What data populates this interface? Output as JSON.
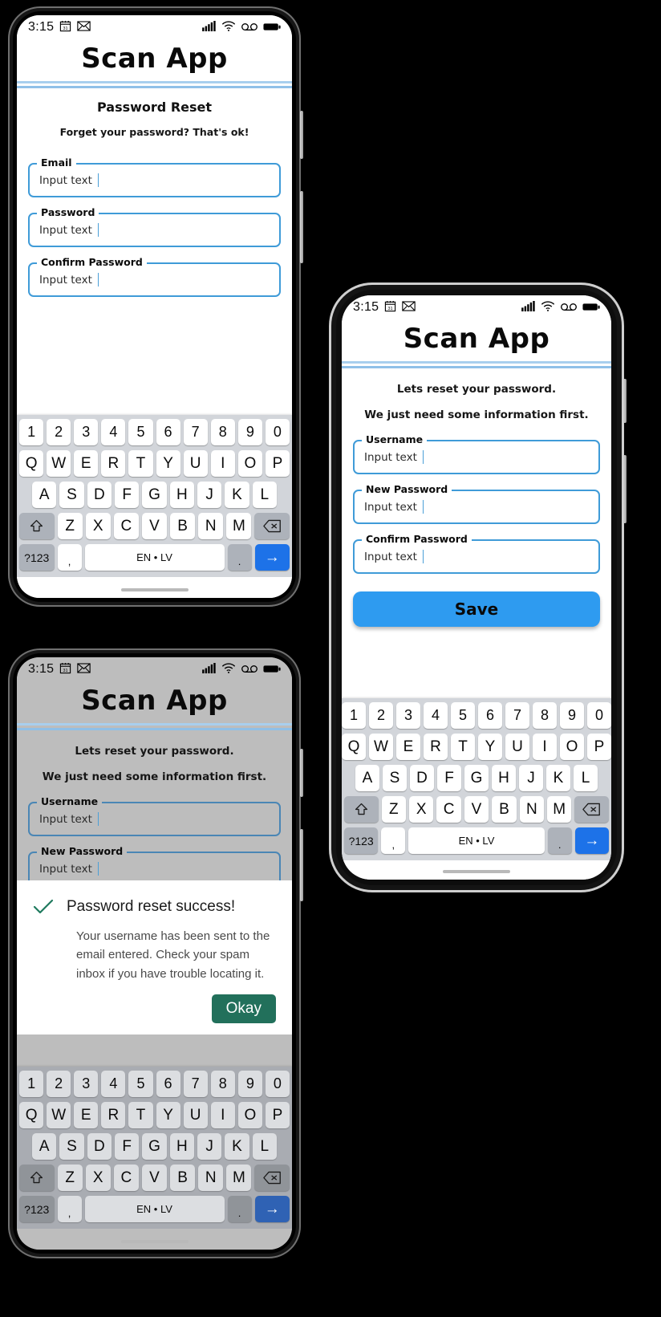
{
  "status_bar": {
    "time": "3:15",
    "left_icons": [
      "calendar-icon",
      "mail-icon"
    ],
    "calendar_day": "31",
    "right_icons": [
      "signal-icon",
      "wifi-icon",
      "voicemail-icon",
      "battery-icon"
    ]
  },
  "app": {
    "title": "Scan App",
    "stripe_color_top": "#a8cfee",
    "stripe_color_bottom": "#8fc0e8"
  },
  "screen1": {
    "heading": "Password Reset",
    "helper": "Forget your password? That's ok!",
    "fields": [
      {
        "label": "Email",
        "value": "Input text"
      },
      {
        "label": "Password",
        "value": "Input text"
      },
      {
        "label": "Confirm Password",
        "value": "Input text"
      }
    ]
  },
  "screen2": {
    "line1": "Lets reset your password.",
    "line2": "We just need some information first.",
    "fields": [
      {
        "label": "Username",
        "value": "Input text"
      },
      {
        "label": "New Password",
        "value": "Input text"
      },
      {
        "label": "Confirm Password",
        "value": "Input text"
      }
    ],
    "save_label": "Save",
    "save_color": "#2e9bf0"
  },
  "screen3": {
    "line1": "Lets reset your password.",
    "line2": "We just need some information first.",
    "fields": [
      {
        "label": "Username",
        "value": "Input text"
      },
      {
        "label": "New Password",
        "value": "Input text"
      }
    ],
    "dialog": {
      "icon": "check-icon",
      "icon_color": "#1f7a5e",
      "title": "Password reset success!",
      "body": "Your username has been sent to the email entered. Check your spam inbox if you have trouble locating it.",
      "confirm_label": "Okay",
      "confirm_color": "#22705b"
    }
  },
  "keyboard": {
    "row_numbers": [
      "1",
      "2",
      "3",
      "4",
      "5",
      "6",
      "7",
      "8",
      "9",
      "0"
    ],
    "row_top": [
      "Q",
      "W",
      "E",
      "R",
      "T",
      "Y",
      "U",
      "I",
      "O",
      "P"
    ],
    "row_home": [
      "A",
      "S",
      "D",
      "F",
      "G",
      "H",
      "J",
      "K",
      "L"
    ],
    "row_bottom": [
      "Z",
      "X",
      "C",
      "V",
      "B",
      "N",
      "M"
    ],
    "shift_key": "shift-icon",
    "backspace_key": "backspace-icon",
    "numeric_key": "?123",
    "comma_key": ",",
    "space_key": "EN • LV",
    "period_key": ".",
    "enter_key": "→",
    "enter_color": "#1d72e8"
  }
}
